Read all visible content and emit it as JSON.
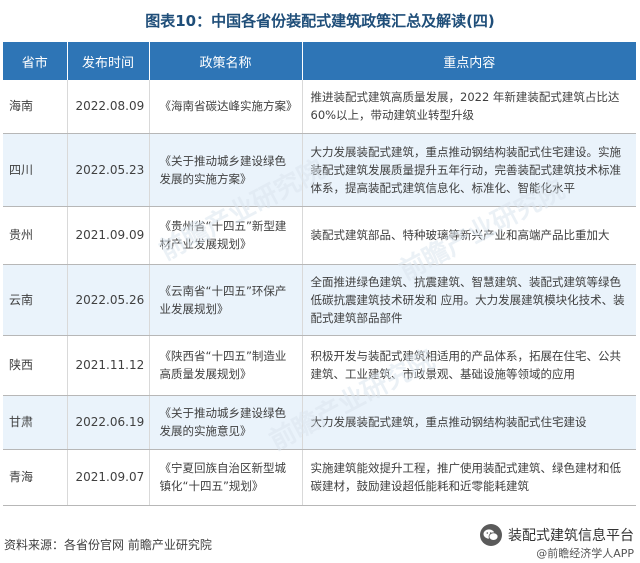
{
  "title": "图表10：中国各省份装配式建筑政策汇总及解读(四)",
  "table": {
    "headers": [
      "省市",
      "发布时间",
      "政策名称",
      "重点内容"
    ],
    "rows": [
      {
        "province": "海南",
        "date": "2022.08.09",
        "policy": "《海南省碳达峰实施方案》",
        "content": "推进装配式建筑高质量发展，2022 年新建装配式建筑占比达 60%以上，带动建筑业转型升级"
      },
      {
        "province": "四川",
        "date": "2022.05.23",
        "policy": "《关于推动城乡建设绿色发展的实施方案》",
        "content": "大力发展装配式建筑，重点推动钢结构装配式住宅建设。实施装配式建筑发展质量提升五年行动，完善装配式建筑技术标准体系，提高装配式建筑信息化、标准化、智能化水平"
      },
      {
        "province": "贵州",
        "date": "2021.09.09",
        "policy": "《贵州省“十四五”新型建材产业发展规划》",
        "content": "装配式建筑部品、特种玻璃等新兴产业和高端产品比重加大"
      },
      {
        "province": "云南",
        "date": "2022.05.26",
        "policy": "《云南省“十四五”环保产业发展规划》",
        "content": "全面推进绿色建筑、抗震建筑、智慧建筑、装配式建筑等绿色低碳抗震建筑技术研发和 应用。大力发展建筑模块化技术、装配式建筑部品部件"
      },
      {
        "province": "陕西",
        "date": "2021.11.12",
        "policy": "《陕西省“十四五”制造业高质量发展规划》",
        "content": "积极开发与装配式建筑相适用的产品体系，拓展在住宅、公共建筑、工业建筑、市政景观、基础设施等领域的应用"
      },
      {
        "province": "甘肃",
        "date": "2022.06.19",
        "policy": "《关于推动城乡建设绿色发展的实施意见》",
        "content": "大力发展装配式建筑，重点推动钢结构装配式住宅建设"
      },
      {
        "province": "青海",
        "date": "2021.09.07",
        "policy": "《宁夏回族自治区新型城镇化“十四五”规划》",
        "content": "实施建筑能效提升工程，推广使用装配式建筑、绿色建材和低碳建材，鼓励建设超低能耗和近零能耗建筑"
      }
    ]
  },
  "footer": {
    "source": "资料来源：各省份官网 前瞻产业研究院",
    "wechat_name": "装配式建筑信息平台",
    "app_label": "@前瞻经济学人APP"
  },
  "watermark_text": "前瞻产业研究院",
  "colors": {
    "header_bg": "#2e75b6",
    "title": "#1f4e79",
    "row_alt": "#eaf3fb"
  },
  "icons": {
    "wechat": "wechat-icon"
  }
}
